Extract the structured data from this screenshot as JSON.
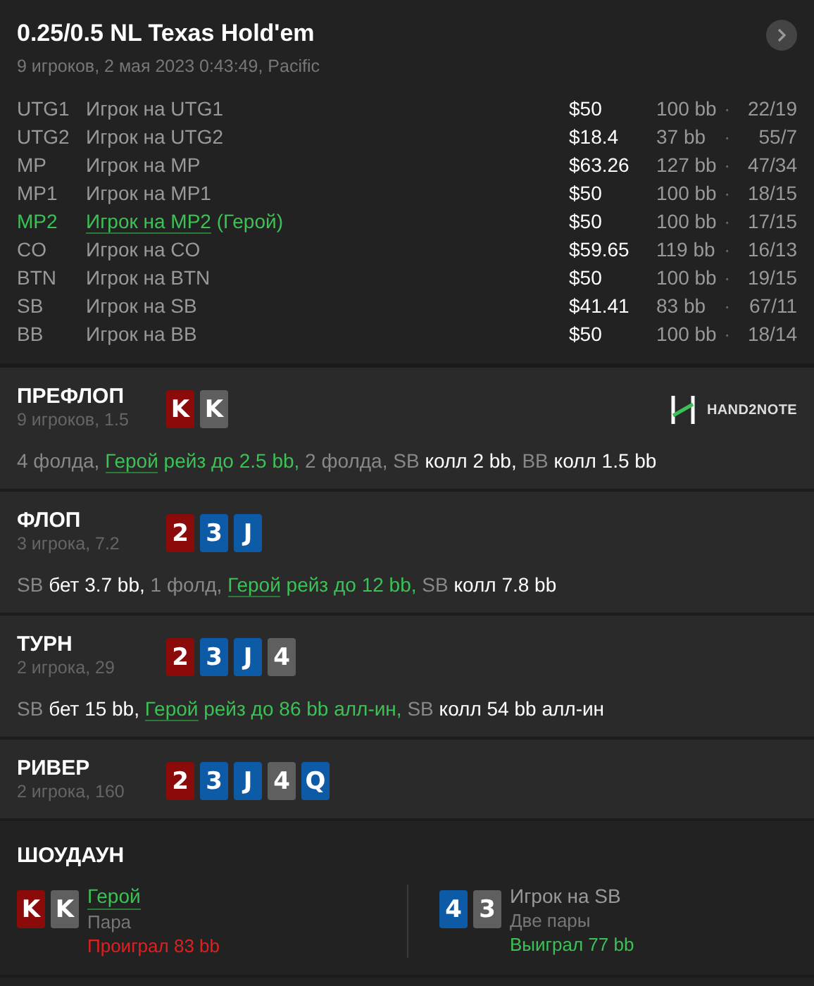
{
  "header": {
    "title": "0.25/0.5 NL Texas Hold'em",
    "subtitle": "9 игроков, 2 мая 2023 0:43:49, Pacific"
  },
  "players": [
    {
      "position": "UTG1",
      "name": "Игрок на UTG1",
      "hero": false,
      "stack": "$50",
      "bb": "100 bb",
      "separator": "·",
      "stats": "22/19"
    },
    {
      "position": "UTG2",
      "name": "Игрок на UTG2",
      "hero": false,
      "stack": "$18.4",
      "bb": "37 bb",
      "separator": "·",
      "stats": "55/7"
    },
    {
      "position": "MP",
      "name": "Игрок на MP",
      "hero": false,
      "stack": "$63.26",
      "bb": "127 bb",
      "separator": "·",
      "stats": "47/34"
    },
    {
      "position": "MP1",
      "name": "Игрок на MP1",
      "hero": false,
      "stack": "$50",
      "bb": "100 bb",
      "separator": "·",
      "stats": "18/15"
    },
    {
      "position": "MP2",
      "name": "Игрок на MP2",
      "hero": true,
      "hero_tag": "(Герой)",
      "stack": "$50",
      "bb": "100 bb",
      "separator": "·",
      "stats": "17/15"
    },
    {
      "position": "CO",
      "name": "Игрок на CO",
      "hero": false,
      "stack": "$59.65",
      "bb": "119 bb",
      "separator": "·",
      "stats": "16/13"
    },
    {
      "position": "BTN",
      "name": "Игрок на BTN",
      "hero": false,
      "stack": "$50",
      "bb": "100 bb",
      "separator": "·",
      "stats": "19/15"
    },
    {
      "position": "SB",
      "name": "Игрок на SB",
      "hero": false,
      "stack": "$41.41",
      "bb": "83 bb",
      "separator": "·",
      "stats": "67/11"
    },
    {
      "position": "BB",
      "name": "Игрок на BB",
      "hero": false,
      "stack": "$50",
      "bb": "100 bb",
      "separator": "·",
      "stats": "18/14"
    }
  ],
  "streets": [
    {
      "name": "ПРЕФЛОП",
      "info": "9 игроков, 1.5",
      "logo": "HAND2NOTE",
      "cards": [
        {
          "rank": "K",
          "color": "#8b0a0a"
        },
        {
          "rank": "K",
          "color": "#5f5f5f"
        }
      ],
      "actions": [
        {
          "kind": "muted",
          "text": "4 фолда, "
        },
        {
          "kind": "hero",
          "text": "Герой"
        },
        {
          "kind": "hero_action",
          "text": " рейз до 2.5 bb, "
        },
        {
          "kind": "muted",
          "text": "2 фолда, SB "
        },
        {
          "kind": "action",
          "text": "колл 2 bb, "
        },
        {
          "kind": "muted",
          "text": "BB "
        },
        {
          "kind": "action",
          "text": "колл 1.5 bb"
        }
      ]
    },
    {
      "name": "ФЛОП",
      "info": "3 игрока, 7.2",
      "cards": [
        {
          "rank": "2",
          "color": "#8b0a0a"
        },
        {
          "rank": "3",
          "color": "#0d5aa7"
        },
        {
          "rank": "J",
          "color": "#0d5aa7"
        }
      ],
      "actions": [
        {
          "kind": "muted",
          "text": "SB "
        },
        {
          "kind": "action",
          "text": "бет 3.7 bb, "
        },
        {
          "kind": "muted",
          "text": "1 фолд, "
        },
        {
          "kind": "hero",
          "text": "Герой"
        },
        {
          "kind": "hero_action",
          "text": " рейз до 12 bb, "
        },
        {
          "kind": "muted",
          "text": "SB "
        },
        {
          "kind": "action",
          "text": "колл 7.8 bb"
        }
      ]
    },
    {
      "name": "ТУРН",
      "info": "2 игрока, 29",
      "cards": [
        {
          "rank": "2",
          "color": "#8b0a0a"
        },
        {
          "rank": "3",
          "color": "#0d5aa7"
        },
        {
          "rank": "J",
          "color": "#0d5aa7"
        },
        {
          "rank": "4",
          "color": "#5f5f5f"
        }
      ],
      "actions": [
        {
          "kind": "muted",
          "text": "SB "
        },
        {
          "kind": "action",
          "text": "бет 15 bb, "
        },
        {
          "kind": "hero",
          "text": "Герой"
        },
        {
          "kind": "hero_action",
          "text": " рейз до 86 bb алл-ин, "
        },
        {
          "kind": "muted",
          "text": "SB "
        },
        {
          "kind": "action",
          "text": "колл 54 bb алл-ин"
        }
      ]
    },
    {
      "name": "РИВЕР",
      "info": "2 игрока, 160",
      "cards": [
        {
          "rank": "2",
          "color": "#8b0a0a"
        },
        {
          "rank": "3",
          "color": "#0d5aa7"
        },
        {
          "rank": "J",
          "color": "#0d5aa7"
        },
        {
          "rank": "4",
          "color": "#5f5f5f"
        },
        {
          "rank": "Q",
          "color": "#0d5aa7"
        }
      ]
    }
  ],
  "showdown": {
    "title": "ШОУДАУН",
    "hands": [
      {
        "name": "Герой",
        "hero": true,
        "hand": "Пара",
        "result": "Проиграл 83 bb",
        "won": false,
        "cards": [
          {
            "rank": "K",
            "color": "#8b0a0a"
          },
          {
            "rank": "K",
            "color": "#5f5f5f"
          }
        ]
      },
      {
        "name": "Игрок на SB",
        "hero": false,
        "hand": "Две пары",
        "result": "Выиграл 77 bb",
        "won": true,
        "cards": [
          {
            "rank": "4",
            "color": "#0d5aa7"
          },
          {
            "rank": "3",
            "color": "#5f5f5f"
          }
        ]
      }
    ]
  }
}
